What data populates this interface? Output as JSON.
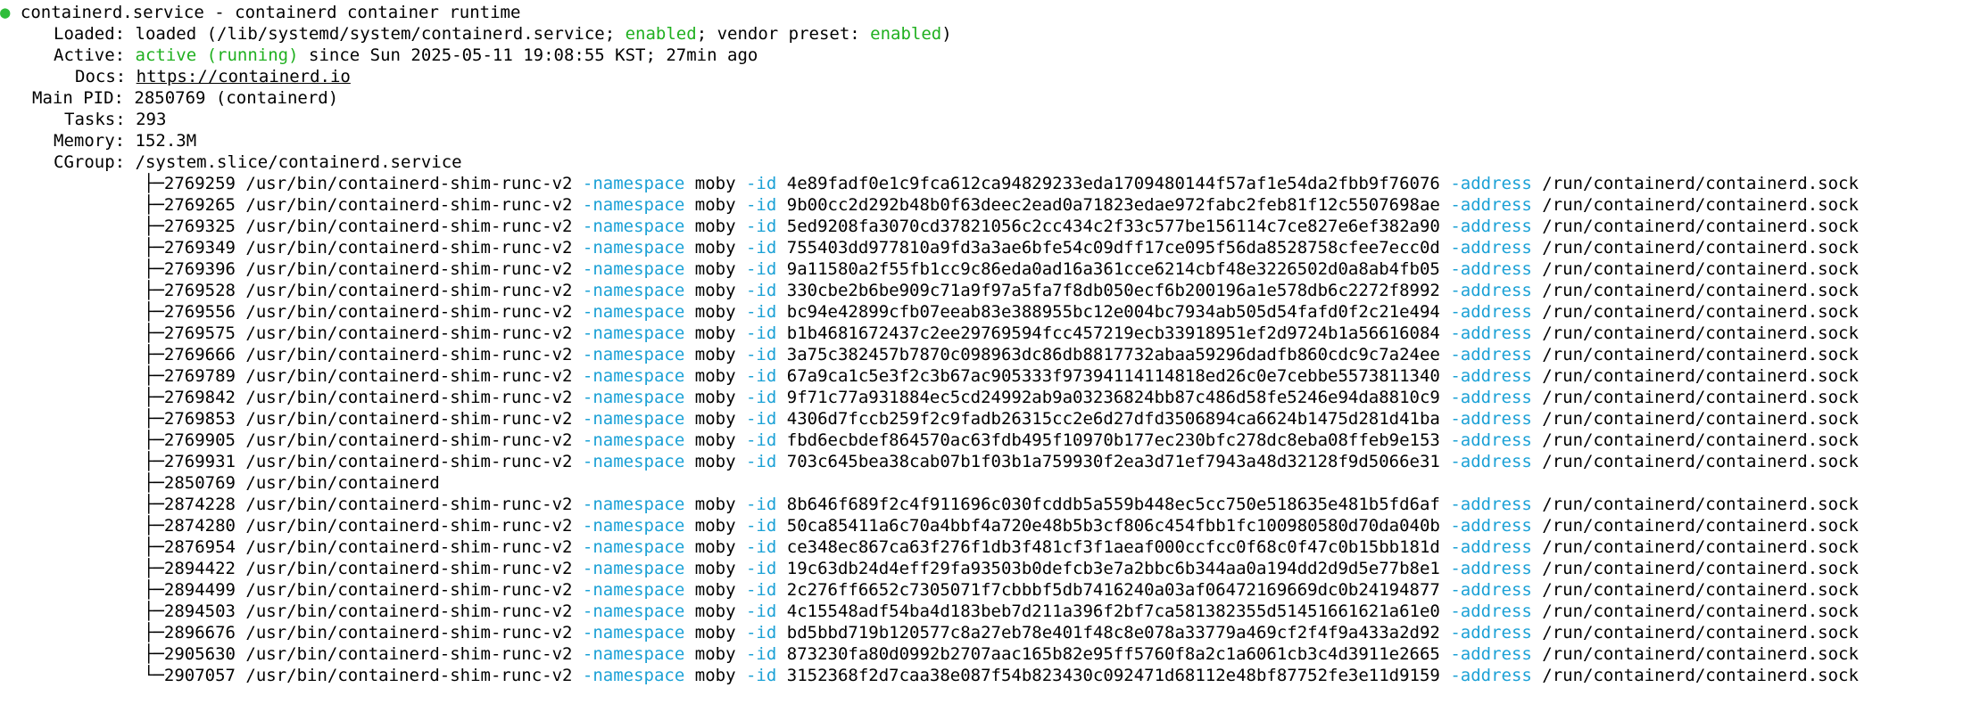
{
  "header": {
    "service": "containerd.service - containerd container runtime"
  },
  "status": {
    "loaded_label": "Loaded:",
    "loaded_prefix": "loaded (/lib/systemd/system/containerd.service; ",
    "loaded_enabled": "enabled",
    "loaded_mid": "; vendor preset: ",
    "loaded_preset": "enabled",
    "loaded_suffix": ")",
    "active_label": "Active:",
    "active_state": "active (running)",
    "active_since": " since Sun 2025-05-11 19:08:55 KST; 27min ago",
    "docs_label": "Docs:",
    "docs_url": "https://containerd.io",
    "mainpid_label": "Main PID:",
    "mainpid_value": "2850769 (containerd)",
    "tasks_label": "Tasks:",
    "tasks_value": "293",
    "memory_label": "Memory:",
    "memory_value": "152.3M",
    "cgroup_label": "CGroup:",
    "cgroup_value": "/system.slice/containerd.service"
  },
  "flags": {
    "namespace": "-namespace",
    "namespace_value": "moby",
    "id": "-id",
    "address": "-address",
    "address_value": "/run/containerd/containerd.sock"
  },
  "processes": [
    {
      "branch": "├─",
      "pid": "2769259",
      "cmd": "/usr/bin/containerd-shim-runc-v2",
      "id": "4e89fadf0e1c9fca612ca94829233eda1709480144f57af1e54da2fbb9f76076",
      "shim": true
    },
    {
      "branch": "├─",
      "pid": "2769265",
      "cmd": "/usr/bin/containerd-shim-runc-v2",
      "id": "9b00cc2d292b48b0f63deec2ead0a71823edae972fabc2feb81f12c5507698ae",
      "shim": true
    },
    {
      "branch": "├─",
      "pid": "2769325",
      "cmd": "/usr/bin/containerd-shim-runc-v2",
      "id": "5ed9208fa3070cd37821056c2cc434c2f33c577be156114c7ce827e6ef382a90",
      "shim": true
    },
    {
      "branch": "├─",
      "pid": "2769349",
      "cmd": "/usr/bin/containerd-shim-runc-v2",
      "id": "755403dd977810a9fd3a3ae6bfe54c09dff17ce095f56da8528758cfee7ecc0d",
      "shim": true
    },
    {
      "branch": "├─",
      "pid": "2769396",
      "cmd": "/usr/bin/containerd-shim-runc-v2",
      "id": "9a11580a2f55fb1cc9c86eda0ad16a361cce6214cbf48e3226502d0a8ab4fb05",
      "shim": true
    },
    {
      "branch": "├─",
      "pid": "2769528",
      "cmd": "/usr/bin/containerd-shim-runc-v2",
      "id": "330cbe2b6be909c71a9f97a5fa7f8db050ecf6b200196a1e578db6c2272f8992",
      "shim": true
    },
    {
      "branch": "├─",
      "pid": "2769556",
      "cmd": "/usr/bin/containerd-shim-runc-v2",
      "id": "bc94e42899cfb07eeab83e388955bc12e004bc7934ab505d54fafd0f2c21e494",
      "shim": true
    },
    {
      "branch": "├─",
      "pid": "2769575",
      "cmd": "/usr/bin/containerd-shim-runc-v2",
      "id": "b1b4681672437c2ee29769594fcc457219ecb33918951ef2d9724b1a56616084",
      "shim": true
    },
    {
      "branch": "├─",
      "pid": "2769666",
      "cmd": "/usr/bin/containerd-shim-runc-v2",
      "id": "3a75c382457b7870c098963dc86db8817732abaa59296dadfb860cdc9c7a24ee",
      "shim": true
    },
    {
      "branch": "├─",
      "pid": "2769789",
      "cmd": "/usr/bin/containerd-shim-runc-v2",
      "id": "67a9ca1c5e3f2c3b67ac905333f97394114114818ed26c0e7cebbe5573811340",
      "shim": true
    },
    {
      "branch": "├─",
      "pid": "2769842",
      "cmd": "/usr/bin/containerd-shim-runc-v2",
      "id": "9f71c77a931884ec5cd24992ab9a03236824bb87c486d58fe5246e94da8810c9",
      "shim": true
    },
    {
      "branch": "├─",
      "pid": "2769853",
      "cmd": "/usr/bin/containerd-shim-runc-v2",
      "id": "4306d7fccb259f2c9fadb26315cc2e6d27dfd3506894ca6624b1475d281d41ba",
      "shim": true
    },
    {
      "branch": "├─",
      "pid": "2769905",
      "cmd": "/usr/bin/containerd-shim-runc-v2",
      "id": "fbd6ecbdef864570ac63fdb495f10970b177ec230bfc278dc8eba08ffeb9e153",
      "shim": true
    },
    {
      "branch": "├─",
      "pid": "2769931",
      "cmd": "/usr/bin/containerd-shim-runc-v2",
      "id": "703c645bea38cab07b1f03b1a759930f2ea3d71ef7943a48d32128f9d5066e31",
      "shim": true
    },
    {
      "branch": "├─",
      "pid": "2850769",
      "cmd": "/usr/bin/containerd",
      "id": "",
      "shim": false
    },
    {
      "branch": "├─",
      "pid": "2874228",
      "cmd": "/usr/bin/containerd-shim-runc-v2",
      "id": "8b646f689f2c4f911696c030fcddb5a559b448ec5cc750e518635e481b5fd6af",
      "shim": true
    },
    {
      "branch": "├─",
      "pid": "2874280",
      "cmd": "/usr/bin/containerd-shim-runc-v2",
      "id": "50ca85411a6c70a4bbf4a720e48b5b3cf806c454fbb1fc100980580d70da040b",
      "shim": true
    },
    {
      "branch": "├─",
      "pid": "2876954",
      "cmd": "/usr/bin/containerd-shim-runc-v2",
      "id": "ce348ec867ca63f276f1db3f481cf3f1aeaf000ccfcc0f68c0f47c0b15bb181d",
      "shim": true
    },
    {
      "branch": "├─",
      "pid": "2894422",
      "cmd": "/usr/bin/containerd-shim-runc-v2",
      "id": "19c63db24d4eff29fa93503b0defcb3e7a2bbc6b344aa0a194dd2d9d5e77b8e1",
      "shim": true
    },
    {
      "branch": "├─",
      "pid": "2894499",
      "cmd": "/usr/bin/containerd-shim-runc-v2",
      "id": "2c276ff6652c7305071f7cbbbf5db7416240a03af06472169669dc0b24194877",
      "shim": true
    },
    {
      "branch": "├─",
      "pid": "2894503",
      "cmd": "/usr/bin/containerd-shim-runc-v2",
      "id": "4c15548adf54ba4d183beb7d211a396f2bf7ca581382355d51451661621a61e0",
      "shim": true
    },
    {
      "branch": "├─",
      "pid": "2896676",
      "cmd": "/usr/bin/containerd-shim-runc-v2",
      "id": "bd5bbd719b120577c8a27eb78e401f48c8e078a33779a469cf2f4f9a433a2d92",
      "shim": true
    },
    {
      "branch": "├─",
      "pid": "2905630",
      "cmd": "/usr/bin/containerd-shim-runc-v2",
      "id": "873230fa80d0992b2707aac165b82e95ff5760f8a2c1a6061cb3c4d3911e2665",
      "shim": true
    },
    {
      "branch": "└─",
      "pid": "2907057",
      "cmd": "/usr/bin/containerd-shim-runc-v2",
      "id": "3152368f2d7caa38e087f54b823430c092471d68112e48bf87752fe3e11d9159",
      "shim": true
    }
  ],
  "colors": {
    "dot": "#2ebd3a",
    "enabled": "#20b020",
    "flag": "#1ba1d6",
    "text": "#000000",
    "background": "#ffffff"
  }
}
